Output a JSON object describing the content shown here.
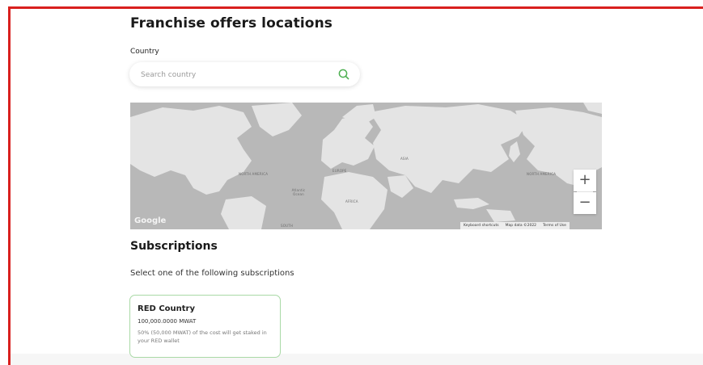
{
  "page": {
    "title": "Franchise offers locations"
  },
  "country": {
    "label": "Country",
    "search_placeholder": "Search country",
    "search_value": ""
  },
  "map": {
    "labels": [
      "NORTH AMERICA",
      "EUROPE",
      "ASIA",
      "AFRICA",
      "NORTH AMERICA",
      "SOUTH"
    ],
    "ocean_label": "Atlantic Ocean",
    "logo": "Google",
    "footer": {
      "shortcuts": "Keyboard shortcuts",
      "map_data": "Map data ©2022",
      "terms": "Terms of Use"
    },
    "zoom_in": "+",
    "zoom_out": "−",
    "colors": {
      "water": "#b8b8b8",
      "land": "#e4e4e4"
    }
  },
  "subscriptions": {
    "title": "Subscriptions",
    "hint": "Select one of the following subscriptions",
    "cards": [
      {
        "title": "RED Country",
        "amount": "100,000.0000 MWAT",
        "note": "50% (50,000 MWAT) of the cost will get staked in your RED wallet"
      }
    ]
  },
  "colors": {
    "accent": "#d9201e",
    "green": "#4caf50",
    "card_border": "#a9d9a6"
  }
}
